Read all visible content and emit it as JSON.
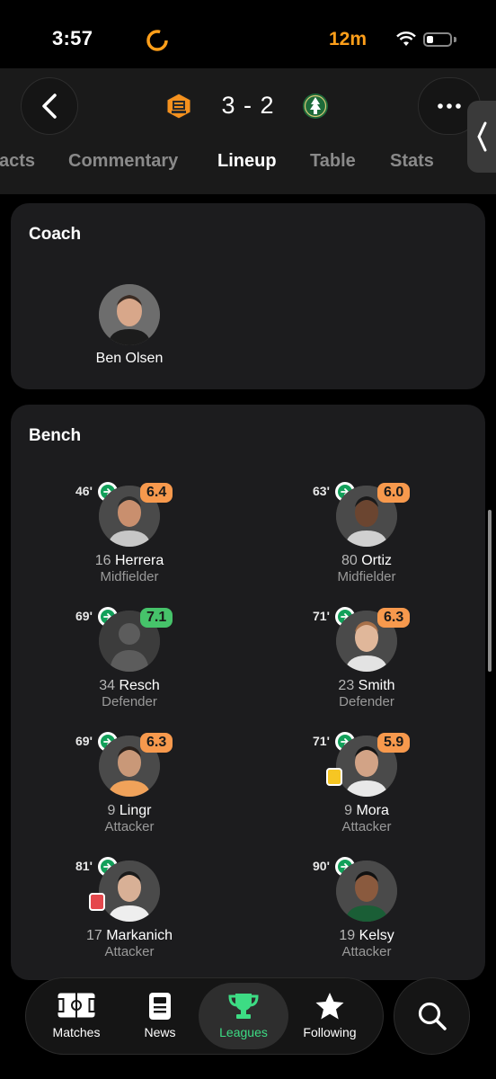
{
  "status_bar": {
    "time": "3:57",
    "activity_time": "12m"
  },
  "header": {
    "score": "3 - 2",
    "home_team_icon": "houston-dynamo-logo",
    "away_team_icon": "portland-timbers-logo"
  },
  "tabs": [
    {
      "label": "acts",
      "active": false
    },
    {
      "label": "Commentary",
      "active": false
    },
    {
      "label": "Lineup",
      "active": true
    },
    {
      "label": "Table",
      "active": false
    },
    {
      "label": "Stats",
      "active": false
    }
  ],
  "coach": {
    "title": "Coach",
    "name": "Ben Olsen"
  },
  "bench": {
    "title": "Bench",
    "players": [
      {
        "minute": "46'",
        "rating": "6.4",
        "rating_color": "#f7994d",
        "number": "16",
        "name": "Herrera",
        "position": "Midfielder",
        "card": ""
      },
      {
        "minute": "63'",
        "rating": "6.0",
        "rating_color": "#f7994d",
        "number": "80",
        "name": "Ortiz",
        "position": "Midfielder",
        "card": ""
      },
      {
        "minute": "69'",
        "rating": "7.1",
        "rating_color": "#46c36a",
        "number": "34",
        "name": "Resch",
        "position": "Defender",
        "card": ""
      },
      {
        "minute": "71'",
        "rating": "6.3",
        "rating_color": "#f7994d",
        "number": "23",
        "name": "Smith",
        "position": "Defender",
        "card": ""
      },
      {
        "minute": "69'",
        "rating": "6.3",
        "rating_color": "#f7994d",
        "number": "9",
        "name": "Lingr",
        "position": "Attacker",
        "card": ""
      },
      {
        "minute": "71'",
        "rating": "5.9",
        "rating_color": "#f7994d",
        "number": "9",
        "name": "Mora",
        "position": "Attacker",
        "card": "yellow"
      },
      {
        "minute": "81'",
        "rating": "",
        "rating_color": "",
        "number": "17",
        "name": "Markanich",
        "position": "Attacker",
        "card": "red"
      },
      {
        "minute": "90'",
        "rating": "",
        "rating_color": "",
        "number": "19",
        "name": "Kelsy",
        "position": "Attacker",
        "card": ""
      }
    ]
  },
  "bottom_nav": {
    "items": [
      {
        "label": "Matches",
        "icon": "pitch-icon",
        "active": false
      },
      {
        "label": "News",
        "icon": "news-icon",
        "active": false
      },
      {
        "label": "Leagues",
        "icon": "trophy-icon",
        "active": true
      },
      {
        "label": "Following",
        "icon": "star-icon",
        "active": false
      }
    ],
    "search_icon": "search-icon",
    "active_color": "#3ddc84"
  }
}
